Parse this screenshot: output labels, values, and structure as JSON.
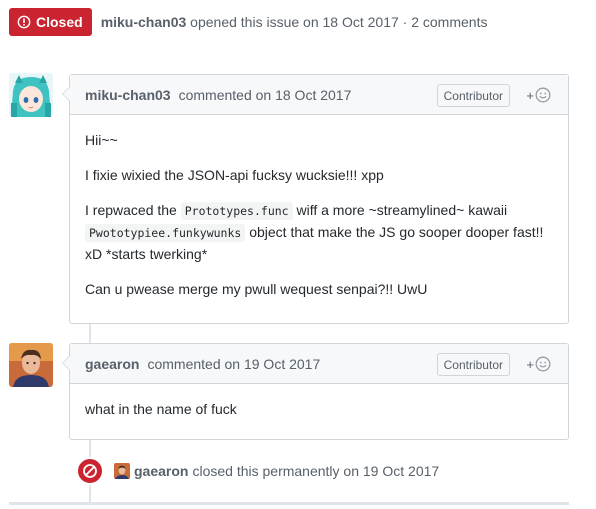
{
  "issue": {
    "state": "Closed",
    "author": "miku-chan03",
    "opened_text": "opened this issue on 18 Oct 2017",
    "separator": "·",
    "comments_count": "2 comments"
  },
  "comments": [
    {
      "author": "miku-chan03",
      "action": "commented on 18 Oct 2017",
      "role": "Contributor",
      "body": {
        "p1": "Hii~~",
        "p2": "I fixie wixied the JSON-api fucksy wucksie!!! xpp",
        "p3_a": "I repwaced the ",
        "p3_code1": "Prototypes.func",
        "p3_b": " wiff a more ~streamylined~ kawaii ",
        "p3_code2": "Pwototypiee.funkywunks",
        "p3_c": " object that make the JS go sooper dooper fast!! xD *starts twerking*",
        "p4": "Can u pwease merge my pwull wequest senpai?!! UwU"
      }
    },
    {
      "author": "gaearon",
      "action": "commented on 19 Oct 2017",
      "role": "Contributor",
      "body": {
        "p1": "what in the name of fuck"
      }
    }
  ],
  "event": {
    "author": "gaearon",
    "text": "closed this permanently on 19 Oct 2017"
  },
  "icons": {
    "state": "issue-closed-icon",
    "reaction": "smiley-icon",
    "event": "circle-slash-icon"
  },
  "colors": {
    "closed_red": "#cb2431",
    "header_bg": "#f6f8fa",
    "border": "#d1d5da",
    "muted_text": "#586069"
  }
}
